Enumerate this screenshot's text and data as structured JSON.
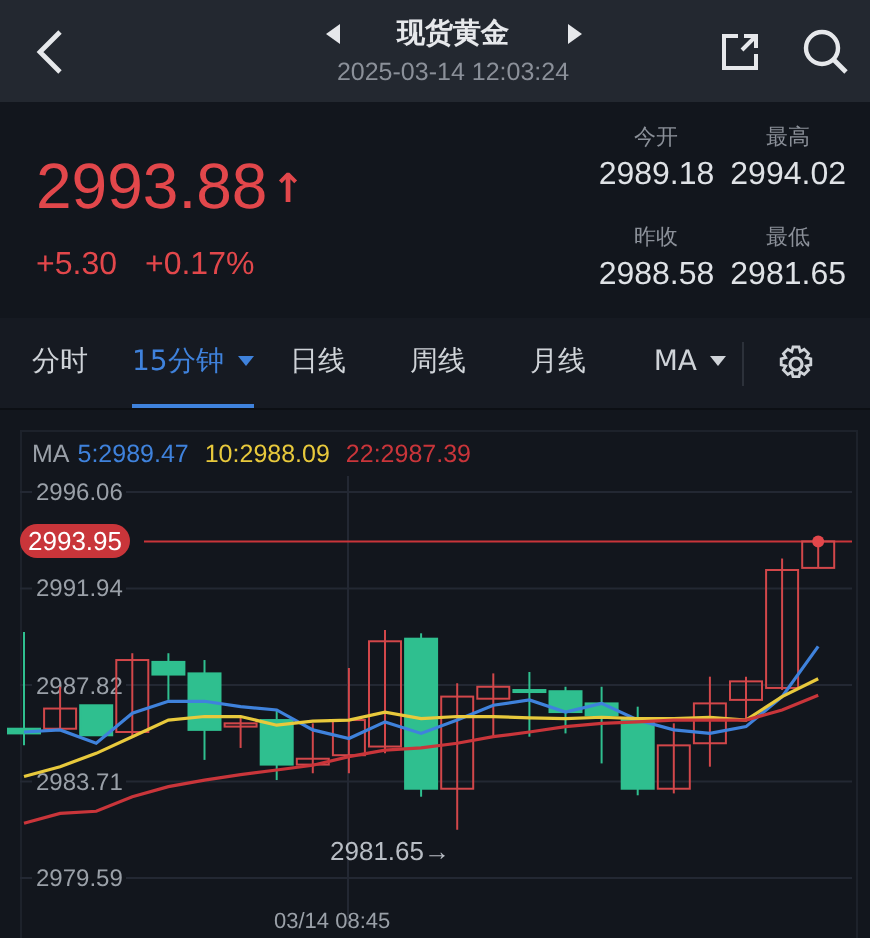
{
  "header": {
    "title": "现货黄金",
    "datetime": "2025-03-14 12:03:24"
  },
  "quote": {
    "price": "2993.88",
    "arrow": "↑",
    "rising": true,
    "change": "+5.30",
    "change_pct": "+0.17%",
    "stats": [
      {
        "label": "今开",
        "value": "2989.18"
      },
      {
        "label": "最高",
        "value": "2994.02"
      },
      {
        "label": "昨收",
        "value": "2988.58"
      },
      {
        "label": "最低",
        "value": "2981.65"
      }
    ]
  },
  "tabs": [
    {
      "label": "分时",
      "selected": false,
      "dropdown": false
    },
    {
      "label": "15分钟",
      "selected": true,
      "dropdown": true
    },
    {
      "label": "日线",
      "selected": false,
      "dropdown": false
    },
    {
      "label": "周线",
      "selected": false,
      "dropdown": false
    },
    {
      "label": "月线",
      "selected": false,
      "dropdown": false
    },
    {
      "label": "MA",
      "selected": false,
      "dropdown": true
    }
  ],
  "chart": {
    "ma_label": "MA",
    "ma": [
      "5:2989.47",
      "10:2988.09",
      "22:2987.39"
    ],
    "low_marker": "2981.65→",
    "x_label": "03/14 08:45",
    "chart_data": {
      "type": "candlestick",
      "grid": true,
      "ylim": [
        2977.63,
        2996.74
      ],
      "yticks": [
        {
          "value": 2996.06,
          "label": "2996.06"
        },
        {
          "value": 2991.94,
          "label": "2991.94"
        },
        {
          "value": 2987.82,
          "label": "2987.82"
        },
        {
          "value": 2983.71,
          "label": "2983.71"
        },
        {
          "value": 2979.59,
          "label": "2979.59"
        }
      ],
      "ref_lines": [
        {
          "axis": "y",
          "value": 2993.95,
          "label": "2993.95",
          "color": "#c9353a"
        }
      ],
      "ohlc": [
        [
          2985.96,
          2990.09,
          2985.25,
          2985.76
        ],
        [
          2985.96,
          2987.75,
          2985.91,
          2986.82
        ],
        [
          2986.96,
          2986.96,
          2985.68,
          2985.68
        ],
        [
          2985.82,
          2989.18,
          2985.62,
          2988.89
        ],
        [
          2988.81,
          2989.18,
          2987.19,
          2988.27
        ],
        [
          2988.32,
          2988.89,
          2984.63,
          2985.91
        ],
        [
          2986.05,
          2986.48,
          2985.14,
          2986.19
        ],
        [
          2986.33,
          2986.76,
          2983.77,
          2984.43
        ],
        [
          2984.43,
          2986.19,
          2984.06,
          2984.68
        ],
        [
          2984.83,
          2988.55,
          2984.06,
          2986.33
        ],
        [
          2985.2,
          2990.17,
          2984.91,
          2989.69
        ],
        [
          2989.8,
          2990.03,
          2983.06,
          2983.4
        ],
        [
          2983.4,
          2987.9,
          2981.65,
          2987.33
        ],
        [
          2987.24,
          2988.32,
          2985.62,
          2987.75
        ],
        [
          2987.61,
          2988.38,
          2985.62,
          2987.53
        ],
        [
          2987.56,
          2987.75,
          2985.76,
          2986.67
        ],
        [
          2987.04,
          2987.75,
          2984.48,
          2986.53
        ],
        [
          2986.33,
          2986.9,
          2983.12,
          2983.4
        ],
        [
          2983.4,
          2986.19,
          2983.2,
          2985.25
        ],
        [
          2985.34,
          2988.18,
          2984.34,
          2987.04
        ],
        [
          2987.19,
          2988.18,
          2986.33,
          2987.98
        ],
        [
          2987.7,
          2993.22,
          2987.61,
          2992.73
        ],
        [
          2992.82,
          2994.02,
          2992.82,
          2993.95
        ]
      ],
      "series": [
        {
          "type": "line",
          "color": "#3f82dc",
          "values": [
            2985.82,
            2985.91,
            2985.34,
            2986.62,
            2987.13,
            2987.13,
            2986.9,
            2986.76,
            2985.91,
            2985.54,
            2986.25,
            2985.76,
            2986.33,
            2986.96,
            2987.19,
            2986.67,
            2987.04,
            2986.33,
            2985.91,
            2985.76,
            2986.05,
            2987.33,
            2989.47
          ]
        },
        {
          "type": "line",
          "color": "#e8c93c",
          "values": [
            2983.92,
            2984.34,
            2984.91,
            2985.62,
            2986.33,
            2986.48,
            2986.48,
            2986.11,
            2986.28,
            2986.33,
            2986.67,
            2986.39,
            2986.48,
            2986.48,
            2986.42,
            2986.39,
            2986.45,
            2986.39,
            2986.39,
            2986.45,
            2986.33,
            2987.33,
            2988.09
          ]
        },
        {
          "type": "line",
          "color": "#c9353a",
          "values": [
            2981.93,
            2982.35,
            2982.44,
            2983.06,
            2983.49,
            2983.77,
            2984.0,
            2984.2,
            2984.4,
            2984.77,
            2985.05,
            2985.14,
            2985.34,
            2985.62,
            2985.82,
            2986.05,
            2986.19,
            2986.25,
            2986.33,
            2986.33,
            2986.33,
            2986.76,
            2987.39
          ]
        }
      ]
    }
  }
}
